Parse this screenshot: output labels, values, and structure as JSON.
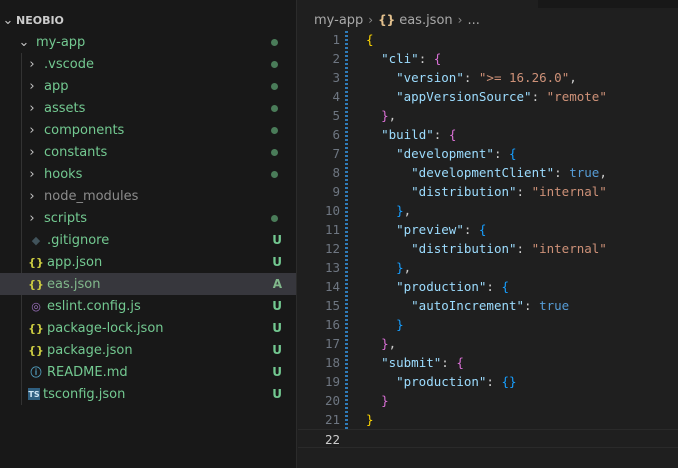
{
  "explorer": {
    "root": "NEOBIO",
    "items": [
      {
        "label": "my-app",
        "kind": "folder-open",
        "depth": 0,
        "color": "#73c991",
        "status": "dot",
        "status_color": "#4a7c59"
      },
      {
        "label": ".vscode",
        "kind": "folder",
        "depth": 1,
        "color": "#73c991",
        "status": "dot",
        "status_color": "#4a7c59"
      },
      {
        "label": "app",
        "kind": "folder",
        "depth": 1,
        "color": "#73c991",
        "status": "dot",
        "status_color": "#4a7c59"
      },
      {
        "label": "assets",
        "kind": "folder",
        "depth": 1,
        "color": "#73c991",
        "status": "dot",
        "status_color": "#4a7c59"
      },
      {
        "label": "components",
        "kind": "folder",
        "depth": 1,
        "color": "#73c991",
        "status": "dot",
        "status_color": "#4a7c59"
      },
      {
        "label": "constants",
        "kind": "folder",
        "depth": 1,
        "color": "#73c991",
        "status": "dot",
        "status_color": "#4a7c59"
      },
      {
        "label": "hooks",
        "kind": "folder",
        "depth": 1,
        "color": "#73c991",
        "status": "dot",
        "status_color": "#4a7c59"
      },
      {
        "label": "node_modules",
        "kind": "folder",
        "depth": 1,
        "color": "#8c8c8c",
        "status": "",
        "status_color": ""
      },
      {
        "label": "scripts",
        "kind": "folder",
        "depth": 1,
        "color": "#73c991",
        "status": "dot",
        "status_color": "#4a7c59"
      },
      {
        "label": ".gitignore",
        "kind": "git",
        "depth": 1,
        "color": "#73c991",
        "status": "U",
        "status_color": "#73c991",
        "icon": "◆",
        "icon_color": "#41535b"
      },
      {
        "label": "app.json",
        "kind": "json",
        "depth": 1,
        "color": "#73c991",
        "status": "U",
        "status_color": "#73c991",
        "icon": "{}",
        "icon_color": "#cbcb41"
      },
      {
        "label": "eas.json",
        "kind": "json",
        "depth": 1,
        "color": "#81b88b",
        "status": "A",
        "status_color": "#81b88b",
        "icon": "{}",
        "icon_color": "#cbcb41",
        "selected": true
      },
      {
        "label": "eslint.config.js",
        "kind": "eslint",
        "depth": 1,
        "color": "#73c991",
        "status": "U",
        "status_color": "#73c991",
        "icon": "◎",
        "icon_color": "#a074c4"
      },
      {
        "label": "package-lock.json",
        "kind": "json",
        "depth": 1,
        "color": "#73c991",
        "status": "U",
        "status_color": "#73c991",
        "icon": "{}",
        "icon_color": "#cbcb41"
      },
      {
        "label": "package.json",
        "kind": "json",
        "depth": 1,
        "color": "#73c991",
        "status": "U",
        "status_color": "#73c991",
        "icon": "{}",
        "icon_color": "#cbcb41"
      },
      {
        "label": "README.md",
        "kind": "info",
        "depth": 1,
        "color": "#73c991",
        "status": "U",
        "status_color": "#73c991",
        "icon": "ⓘ",
        "icon_color": "#519aba"
      },
      {
        "label": "tsconfig.json",
        "kind": "ts",
        "depth": 1,
        "color": "#73c991",
        "status": "U",
        "status_color": "#73c991",
        "icon": "TS",
        "icon_color": "#519aba"
      }
    ]
  },
  "breadcrumb": {
    "folder": "my-app",
    "file_icon": "{}",
    "file": "eas.json",
    "more": "..."
  },
  "editor": {
    "current_line": 22,
    "lines": [
      [
        {
          "t": "{",
          "c": "b1"
        }
      ],
      [
        {
          "t": "  "
        },
        {
          "t": "\"cli\"",
          "c": "t-key"
        },
        {
          "t": ": "
        },
        {
          "t": "{",
          "c": "b2"
        }
      ],
      [
        {
          "t": "    "
        },
        {
          "t": "\"version\"",
          "c": "t-key"
        },
        {
          "t": ": "
        },
        {
          "t": "\">= 16.26.0\"",
          "c": "t-str"
        },
        {
          "t": ","
        }
      ],
      [
        {
          "t": "    "
        },
        {
          "t": "\"appVersionSource\"",
          "c": "t-key"
        },
        {
          "t": ": "
        },
        {
          "t": "\"remote\"",
          "c": "t-str"
        }
      ],
      [
        {
          "t": "  "
        },
        {
          "t": "}",
          "c": "b2"
        },
        {
          "t": ","
        }
      ],
      [
        {
          "t": "  "
        },
        {
          "t": "\"build\"",
          "c": "t-key"
        },
        {
          "t": ": "
        },
        {
          "t": "{",
          "c": "b2"
        }
      ],
      [
        {
          "t": "    "
        },
        {
          "t": "\"development\"",
          "c": "t-key"
        },
        {
          "t": ": "
        },
        {
          "t": "{",
          "c": "b3"
        }
      ],
      [
        {
          "t": "      "
        },
        {
          "t": "\"developmentClient\"",
          "c": "t-key"
        },
        {
          "t": ": "
        },
        {
          "t": "true",
          "c": "t-bool"
        },
        {
          "t": ","
        }
      ],
      [
        {
          "t": "      "
        },
        {
          "t": "\"distribution\"",
          "c": "t-key"
        },
        {
          "t": ": "
        },
        {
          "t": "\"internal\"",
          "c": "t-str"
        }
      ],
      [
        {
          "t": "    "
        },
        {
          "t": "}",
          "c": "b3"
        },
        {
          "t": ","
        }
      ],
      [
        {
          "t": "    "
        },
        {
          "t": "\"preview\"",
          "c": "t-key"
        },
        {
          "t": ": "
        },
        {
          "t": "{",
          "c": "b3"
        }
      ],
      [
        {
          "t": "      "
        },
        {
          "t": "\"distribution\"",
          "c": "t-key"
        },
        {
          "t": ": "
        },
        {
          "t": "\"internal\"",
          "c": "t-str"
        }
      ],
      [
        {
          "t": "    "
        },
        {
          "t": "}",
          "c": "b3"
        },
        {
          "t": ","
        }
      ],
      [
        {
          "t": "    "
        },
        {
          "t": "\"production\"",
          "c": "t-key"
        },
        {
          "t": ": "
        },
        {
          "t": "{",
          "c": "b3"
        }
      ],
      [
        {
          "t": "      "
        },
        {
          "t": "\"autoIncrement\"",
          "c": "t-key"
        },
        {
          "t": ": "
        },
        {
          "t": "true",
          "c": "t-bool"
        }
      ],
      [
        {
          "t": "    "
        },
        {
          "t": "}",
          "c": "b3"
        }
      ],
      [
        {
          "t": "  "
        },
        {
          "t": "}",
          "c": "b2"
        },
        {
          "t": ","
        }
      ],
      [
        {
          "t": "  "
        },
        {
          "t": "\"submit\"",
          "c": "t-key"
        },
        {
          "t": ": "
        },
        {
          "t": "{",
          "c": "b2"
        }
      ],
      [
        {
          "t": "    "
        },
        {
          "t": "\"production\"",
          "c": "t-key"
        },
        {
          "t": ": "
        },
        {
          "t": "{}",
          "c": "b3"
        }
      ],
      [
        {
          "t": "  "
        },
        {
          "t": "}",
          "c": "b2"
        }
      ],
      [
        {
          "t": "}",
          "c": "b1"
        }
      ],
      []
    ]
  }
}
